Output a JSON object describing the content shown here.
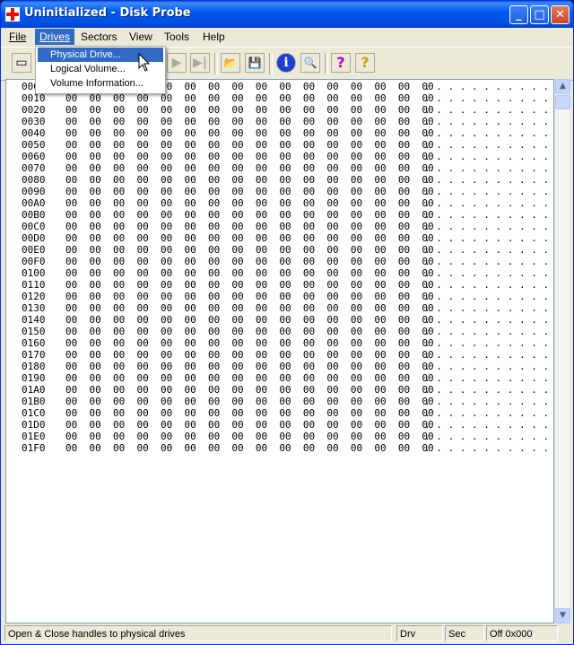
{
  "window": {
    "title": "Uninitialized - Disk Probe",
    "minimize_glyph": "_",
    "maximize_glyph": "□",
    "close_glyph": "✕",
    "icon": "red-cross-icon"
  },
  "menubar": {
    "items": [
      "File",
      "Drives",
      "Sectors",
      "View",
      "Tools",
      "Help"
    ]
  },
  "drives_menu": {
    "items": [
      "Physical Drive...",
      "Logical Volume...",
      "Volume Information..."
    ]
  },
  "toolbar": {
    "buttons": [
      {
        "icon": "read-sector-icon",
        "glyph": "▭"
      },
      {
        "icon": "next-icon",
        "glyph": "▶"
      },
      {
        "icon": "last-icon",
        "glyph": "▶|"
      },
      {
        "icon": "open-folder-icon",
        "glyph": "📂"
      },
      {
        "icon": "save-icon",
        "glyph": "💾"
      },
      {
        "icon": "info-icon",
        "glyph": "i"
      },
      {
        "icon": "search-icon",
        "glyph": "🔍"
      },
      {
        "icon": "help-icon",
        "glyph": "?"
      },
      {
        "icon": "context-help-icon",
        "glyph": "?"
      }
    ]
  },
  "hex_view": {
    "offsets": [
      "0000",
      "0010",
      "0020",
      "0030",
      "0040",
      "0050",
      "0060",
      "0070",
      "0080",
      "0090",
      "00A0",
      "00B0",
      "00C0",
      "00D0",
      "00E0",
      "00F0",
      "0100",
      "0110",
      "0120",
      "0130",
      "0140",
      "0150",
      "0160",
      "0170",
      "0180",
      "0190",
      "01A0",
      "01B0",
      "01C0",
      "01D0",
      "01E0",
      "01F0"
    ],
    "bytes_line": "00  00  00  00  00  00  00  00  00  00  00  00  00  00  00  00",
    "ascii_line": ". . . . . . . . . . . . . . . ."
  },
  "statusbar": {
    "message": "Open & Close handles to physical drives",
    "drv": "Drv",
    "sec": "Sec",
    "off": "Off 0x000"
  },
  "colors": {
    "titlebar": "#0058ee",
    "menu_highlight": "#316ac5",
    "window_bg": "#ece9d8"
  }
}
